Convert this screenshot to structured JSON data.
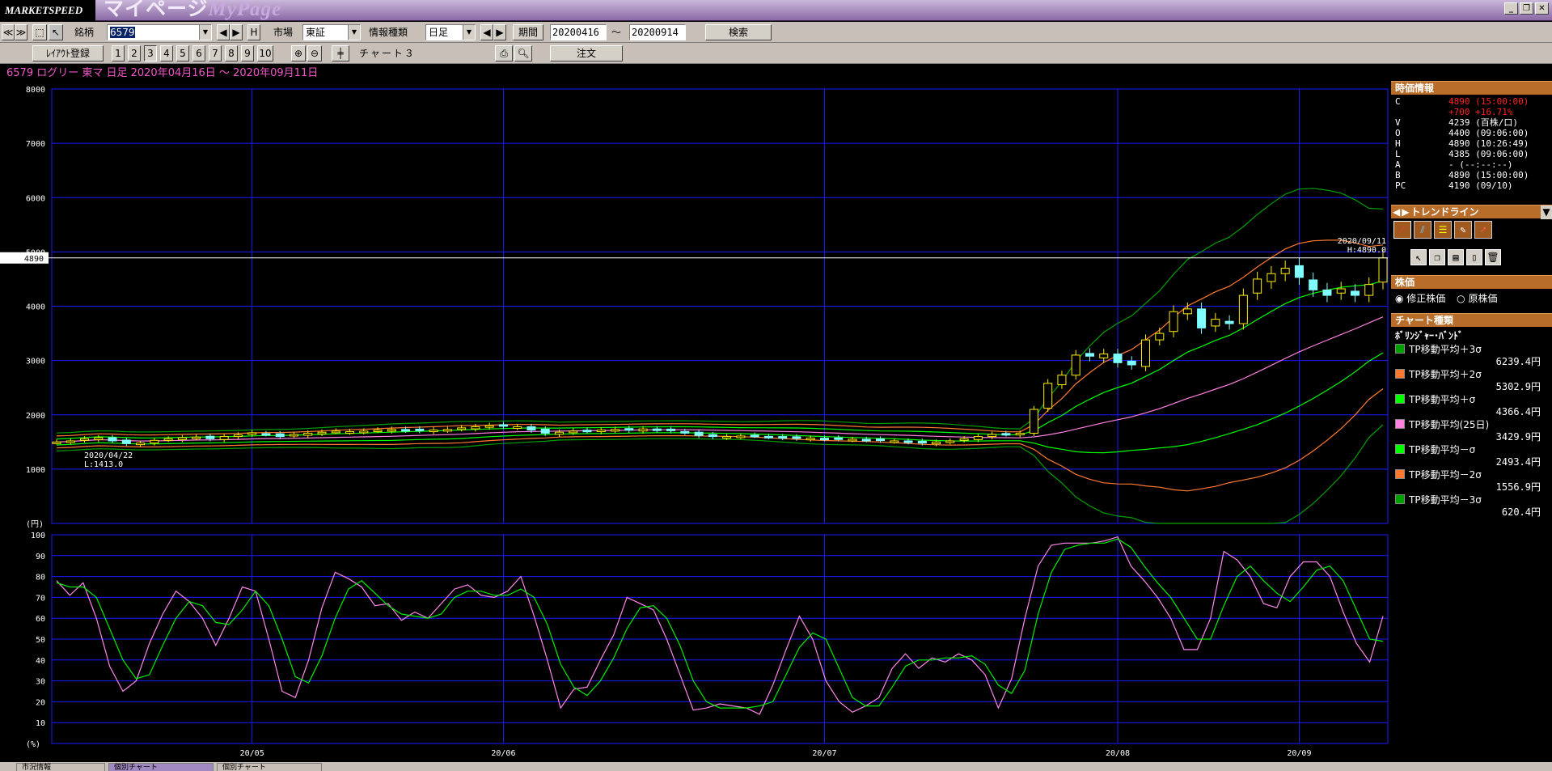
{
  "window": {
    "brand": "MARKETSPEED",
    "title": "マイページ",
    "title_ghost": "MyPage",
    "controls": [
      "_",
      "❐",
      "✕"
    ]
  },
  "toolbar1": {
    "nav_prev": "≪",
    "nav_next": "≫",
    "symbol_label": "銘柄",
    "symbol_value": "6579",
    "h_button": "H",
    "market_label": "市場",
    "market_value": "東証",
    "info_label": "情報種類",
    "info_value": "日足",
    "period_label": "期間",
    "period_from": "20200416",
    "period_sep": "〜",
    "period_to": "20200914",
    "search_button": "検索"
  },
  "toolbar2": {
    "layout_button": "ﾚｲｱｳﾄ登録",
    "layout_numbers": [
      "1",
      "2",
      "3",
      "4",
      "5",
      "6",
      "7",
      "8",
      "9",
      "10"
    ],
    "chart_label": "チャート３",
    "order_button": "注文"
  },
  "chart_header": "6579  ログリー   東マ   日足   2020年04月16日 〜 2020年09月11日",
  "chart_data": [
    {
      "type": "candlestick",
      "ylim": [
        0,
        8000
      ],
      "y_ticks": [
        "8000",
        "7000",
        "6000",
        "5000",
        "4000",
        "3000",
        "2000",
        "1000"
      ],
      "y_unit": "(円)",
      "current_price_marker": "4890",
      "annotations": [
        {
          "date": "2020/09/11",
          "text": "H:4890.0"
        },
        {
          "date": "2020/04/22",
          "text": "L:1413.0"
        }
      ],
      "x_ticks": [
        "20/05",
        "20/06",
        "20/07",
        "20/08",
        "20/09"
      ],
      "approx_close": [
        1500,
        1520,
        1560,
        1580,
        1520,
        1470,
        1480,
        1530,
        1560,
        1580,
        1590,
        1560,
        1600,
        1630,
        1670,
        1650,
        1600,
        1640,
        1660,
        1680,
        1700,
        1690,
        1700,
        1720,
        1730,
        1720,
        1710,
        1720,
        1730,
        1760,
        1780,
        1800,
        1790,
        1780,
        1720,
        1660,
        1680,
        1700,
        1710,
        1720,
        1730,
        1720,
        1740,
        1720,
        1710,
        1680,
        1620,
        1600,
        1600,
        1610,
        1620,
        1600,
        1580,
        1570,
        1570,
        1560,
        1560,
        1550,
        1540,
        1530,
        1520,
        1500,
        1480,
        1500,
        1520,
        1560,
        1600,
        1640,
        1650,
        1660,
        2100,
        2580,
        2730,
        3100,
        3080,
        3120,
        2960,
        2920,
        3380,
        3500,
        3900,
        3950,
        3600,
        3760,
        3680,
        4200,
        4500,
        4600,
        4700,
        4530,
        4300,
        4200,
        4320,
        4200,
        4400,
        4890
      ],
      "bands": [
        {
          "name": "TP移動平均＋3σ",
          "value": "6239.4円",
          "color": "#00a000",
          "ends": [
            1760,
            6240
          ]
        },
        {
          "name": "TP移動平均＋2σ",
          "value": "5302.9円",
          "color": "#ff7a30",
          "ends": [
            1700,
            5303
          ]
        },
        {
          "name": "TP移動平均＋σ",
          "value": "4366.4円",
          "color": "#00ff00",
          "ends": [
            1640,
            4366
          ]
        },
        {
          "name": "TP移動平均(25日)",
          "value": "3429.9円",
          "color": "#ff80e0",
          "ends": [
            1580,
            3430
          ]
        },
        {
          "name": "TP移動平均－σ",
          "value": "2493.4円",
          "color": "#00ff00",
          "ends": [
            1520,
            2493
          ]
        },
        {
          "name": "TP移動平均－2σ",
          "value": "1556.9円",
          "color": "#ff7a30",
          "ends": [
            1460,
            1557
          ]
        },
        {
          "name": "TP移動平均－3σ",
          "value": "620.4円",
          "color": "#00a000",
          "ends": [
            1400,
            620
          ]
        }
      ]
    },
    {
      "type": "line",
      "ylim": [
        0,
        100
      ],
      "y_ticks": [
        "100",
        "90",
        "80",
        "70",
        "60",
        "50",
        "40",
        "30",
        "20",
        "10"
      ],
      "y_unit": "(%)",
      "series": [
        {
          "color": "#ff88ee",
          "values": [
            78,
            71,
            77,
            60,
            37,
            25,
            30,
            48,
            62,
            73,
            68,
            60,
            47,
            60,
            75,
            73,
            50,
            25,
            22,
            40,
            65,
            82,
            79,
            75,
            66,
            67,
            59,
            63,
            60,
            67,
            74,
            76,
            71,
            70,
            73,
            80,
            61,
            40,
            17,
            26,
            27,
            40,
            52,
            70,
            67,
            64,
            50,
            33,
            16,
            17,
            19,
            18,
            17,
            14,
            28,
            45,
            61,
            50,
            30,
            20,
            15,
            18,
            22,
            36,
            43,
            36,
            41,
            39,
            43,
            40,
            33,
            17,
            31,
            60,
            85,
            95,
            96,
            96,
            96,
            97,
            99,
            85,
            78,
            70,
            60,
            45,
            45,
            60,
            92,
            88,
            80,
            67,
            65,
            80,
            87,
            87,
            80,
            63,
            48,
            39,
            61
          ]
        },
        {
          "color": "#00ee00",
          "values": [
            77,
            75,
            75,
            70,
            55,
            40,
            31,
            33,
            47,
            60,
            68,
            66,
            58,
            57,
            64,
            73,
            66,
            50,
            32,
            29,
            42,
            60,
            74,
            78,
            72,
            66,
            62,
            61,
            60,
            62,
            70,
            73,
            73,
            71,
            71,
            74,
            70,
            57,
            38,
            27,
            23,
            30,
            41,
            55,
            65,
            66,
            60,
            47,
            30,
            20,
            17,
            17,
            17,
            18,
            20,
            33,
            46,
            53,
            50,
            36,
            22,
            18,
            18,
            27,
            37,
            40,
            40,
            41,
            41,
            42,
            38,
            28,
            24,
            35,
            62,
            82,
            93,
            95,
            96,
            96,
            98,
            94,
            85,
            77,
            70,
            60,
            50,
            50,
            66,
            80,
            85,
            78,
            72,
            68,
            75,
            83,
            85,
            78,
            64,
            50,
            49
          ]
        }
      ]
    }
  ],
  "sidebar": {
    "quote_title": "時価情報",
    "quote": [
      {
        "k": "C",
        "v": "4890 (15:00:00)",
        "color": "#ff2020"
      },
      {
        "k": "",
        "v": "+700 +16.71%",
        "color": "#ff2020"
      },
      {
        "k": "V",
        "v": "4239 (百株/口)",
        "color": "#ffffff"
      },
      {
        "k": "O",
        "v": "4400 (09:06:00)",
        "color": "#ffffff"
      },
      {
        "k": "H",
        "v": "4890 (10:26:49)",
        "color": "#ffffff"
      },
      {
        "k": "L",
        "v": "4385 (09:06:00)",
        "color": "#ffffff"
      },
      {
        "k": "A",
        "v": "- (--:--:--)",
        "color": "#ffffff"
      },
      {
        "k": "B",
        "v": "4890 (15:00:00)",
        "color": "#ffffff"
      },
      {
        "k": "PC",
        "v": "4190 (09/10)",
        "color": "#ffffff"
      }
    ],
    "trendline_title": "トレンドライン",
    "price_title": "株価",
    "price_options": [
      "修正株価",
      "原株価"
    ],
    "chart_type_title": "チャート種類",
    "chart_type_name": "ﾎﾞﾘﾝｼﾞｬｰ･ﾊﾞﾝﾄﾞ"
  },
  "statusbar": {
    "tabs": [
      "市況情報",
      "個別チャート",
      "個別チャート"
    ]
  }
}
